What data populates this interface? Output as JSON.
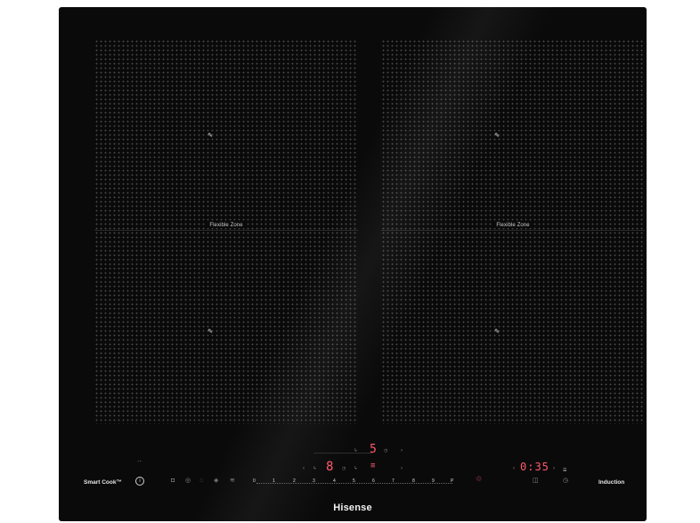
{
  "zones": {
    "left_label": "Flexible Zone",
    "right_label": "Flexible Zone"
  },
  "controls": {
    "smart_cook_label": "Smart Cook™",
    "induction_label": "Induction",
    "brand": "Hisense",
    "zone_level": "8",
    "top_level": "5",
    "timer_display": "0:35",
    "slider_steps": [
      "0",
      "1",
      "2",
      "3",
      "4",
      "5",
      "6",
      "7",
      "8",
      "9",
      "P"
    ]
  },
  "colors": {
    "glass": "#0a0a0b",
    "display_red": "#ff5b6a",
    "text_white": "#e6e6e6"
  }
}
